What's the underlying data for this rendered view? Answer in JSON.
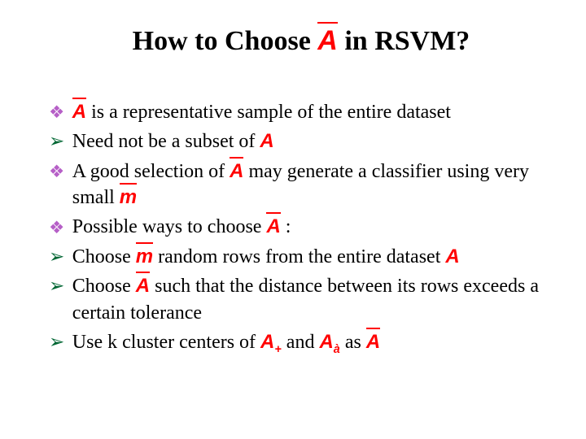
{
  "title_part1": "How to Choose ",
  "title_sym": "A",
  "title_part2": " in RSVM?",
  "b1_sym": "A",
  "b1_text": "  is a representative sample of the entire dataset",
  "b1a_text": "Need not be a subset of ",
  "b1a_sym": "A",
  "b2_text1": "A good selection  of ",
  "b2_sym1": "A",
  "b2_text2": "  may generate a classifier using very small ",
  "b2_sym2": "m",
  "b3_text": "Possible ways to choose ",
  "b3_sym": "A",
  "b3_colon": "  :",
  "b3a_text1": "Choose ",
  "b3a_sym1": "m",
  "b3a_text2": " random rows from the entire dataset ",
  "b3a_sym2": "A",
  "b3b_text1": "Choose ",
  "b3b_sym1": "A",
  "b3b_text2": " such that the distance between its rows exceeds a certain tolerance",
  "b3c_text1": "Use k cluster centers   of ",
  "b3c_sym1": "A",
  "b3c_sub1": "+",
  "b3c_text2": " and ",
  "b3c_sym2": "A",
  "b3c_sub2": "à",
  "b3c_text3": " as ",
  "b3c_sym3": "A"
}
